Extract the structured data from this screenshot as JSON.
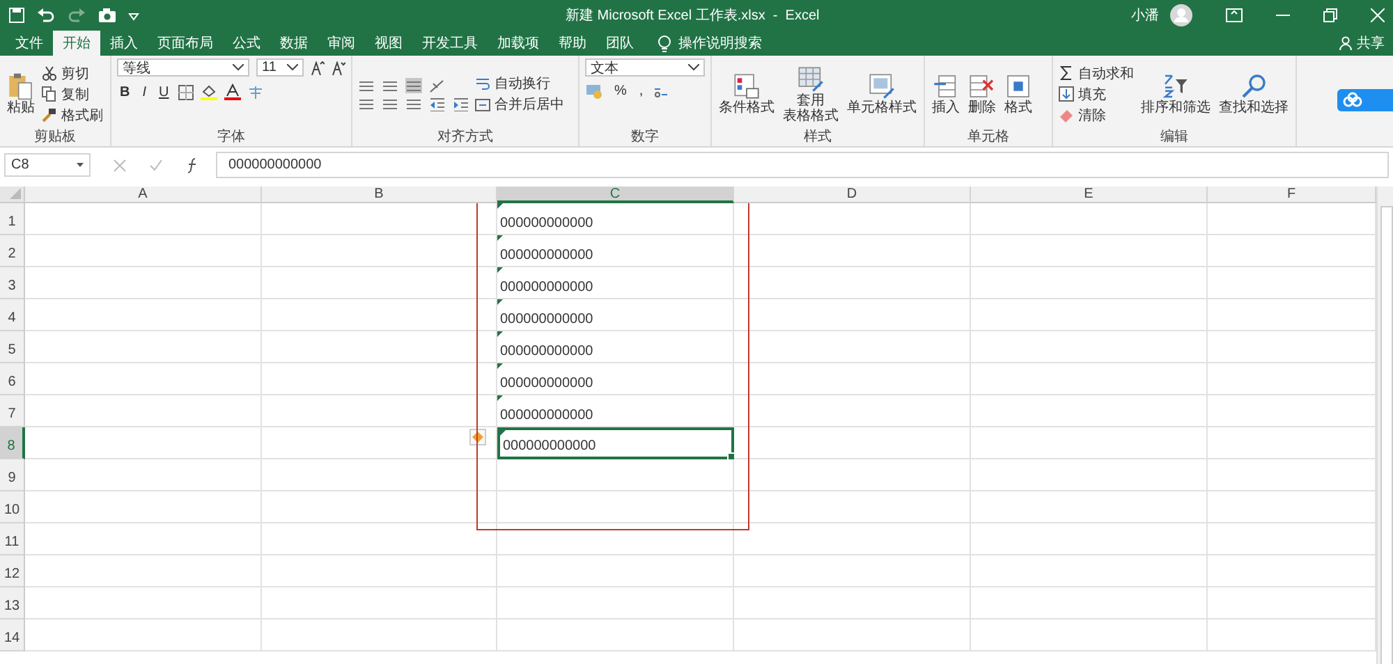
{
  "title_bar": {
    "title": "新建 Microsoft Excel 工作表.xlsx  -  Excel",
    "user": "小潘"
  },
  "tabs": [
    {
      "label": "文件",
      "selected": false
    },
    {
      "label": "开始",
      "selected": true
    },
    {
      "label": "插入",
      "selected": false
    },
    {
      "label": "页面布局",
      "selected": false
    },
    {
      "label": "公式",
      "selected": false
    },
    {
      "label": "数据",
      "selected": false
    },
    {
      "label": "审阅",
      "selected": false
    },
    {
      "label": "视图",
      "selected": false
    },
    {
      "label": "开发工具",
      "selected": false
    },
    {
      "label": "加载项",
      "selected": false
    },
    {
      "label": "帮助",
      "selected": false
    },
    {
      "label": "团队",
      "selected": false
    }
  ],
  "tell_me": "操作说明搜索",
  "share": "共享",
  "ribbon": {
    "clipboard": {
      "label": "剪贴板",
      "paste": "粘贴",
      "cut": "剪切",
      "copy": "复制",
      "format_painter": "格式刷"
    },
    "font": {
      "label": "字体",
      "font_name": "等线",
      "font_size": "11",
      "bold": "B",
      "italic": "I",
      "underline": "U"
    },
    "alignment": {
      "label": "对齐方式",
      "wrap_text": "自动换行",
      "merge_center": "合并后居中"
    },
    "number": {
      "label": "数字",
      "format": "文本",
      "percent": "%",
      "comma": ","
    },
    "styles": {
      "label": "样式",
      "conditional": "条件格式",
      "table_format": [
        "套用",
        "表格格式"
      ],
      "cell_styles": "单元格样式"
    },
    "cells": {
      "label": "单元格",
      "insert": "插入",
      "delete": "删除",
      "format": "格式"
    },
    "editing": {
      "label": "编辑",
      "autosum": "自动求和",
      "fill": "填充",
      "clear": "清除",
      "sort_filter": "排序和筛选",
      "find_select": "查找和选择"
    }
  },
  "formula_bar": {
    "name_box": "C8",
    "formula": "000000000000"
  },
  "sheet": {
    "columns": [
      {
        "label": "A",
        "selected": false
      },
      {
        "label": "B",
        "selected": false
      },
      {
        "label": "C",
        "selected": true
      },
      {
        "label": "D",
        "selected": false
      },
      {
        "label": "E",
        "selected": false
      },
      {
        "label": "F",
        "selected": false
      }
    ],
    "rows": [
      {
        "label": "1",
        "selected": false,
        "cells": [
          null,
          null,
          {
            "value": "000000000000",
            "flagged": true,
            "active": false
          }
        ]
      },
      {
        "label": "2",
        "selected": false,
        "cells": [
          null,
          null,
          {
            "value": "000000000000",
            "flagged": true,
            "active": false
          }
        ]
      },
      {
        "label": "3",
        "selected": false,
        "cells": [
          null,
          null,
          {
            "value": "000000000000",
            "flagged": true,
            "active": false
          }
        ]
      },
      {
        "label": "4",
        "selected": false,
        "cells": [
          null,
          null,
          {
            "value": "000000000000",
            "flagged": true,
            "active": false
          }
        ]
      },
      {
        "label": "5",
        "selected": false,
        "cells": [
          null,
          null,
          {
            "value": "000000000000",
            "flagged": true,
            "active": false
          }
        ]
      },
      {
        "label": "6",
        "selected": false,
        "cells": [
          null,
          null,
          {
            "value": "000000000000",
            "flagged": true,
            "active": false
          }
        ]
      },
      {
        "label": "7",
        "selected": false,
        "cells": [
          null,
          null,
          {
            "value": "000000000000",
            "flagged": true,
            "active": false
          }
        ]
      },
      {
        "label": "8",
        "selected": true,
        "cells": [
          null,
          null,
          {
            "value": "000000000000",
            "flagged": true,
            "active": true,
            "smart_tag": true
          }
        ]
      },
      {
        "label": "9",
        "selected": false
      },
      {
        "label": "10",
        "selected": false
      },
      {
        "label": "11",
        "selected": false
      },
      {
        "label": "12",
        "selected": false
      },
      {
        "label": "13",
        "selected": false
      },
      {
        "label": "14",
        "selected": false
      }
    ]
  }
}
